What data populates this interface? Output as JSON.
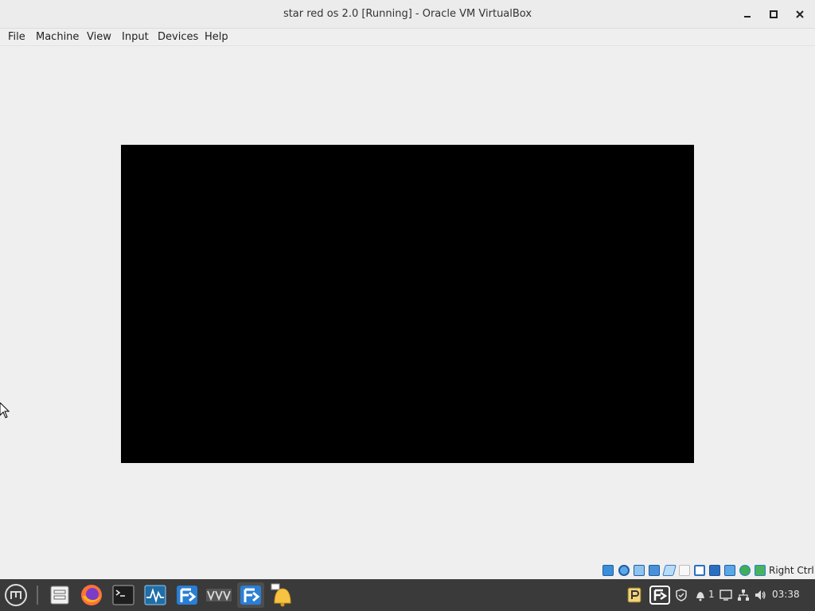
{
  "window": {
    "title": "star red os 2.0 [Running] - Oracle VM VirtualBox",
    "controls": [
      "minimize-icon",
      "maximize-icon",
      "close-icon"
    ]
  },
  "menu": {
    "items": [
      "File",
      "Machine",
      "View",
      "Input",
      "Devices",
      "Help"
    ]
  },
  "vm": {
    "screen_color": "#000000"
  },
  "statusbar": {
    "icons": [
      "hard-disk-icon",
      "optical-drive-icon",
      "audio-icon",
      "network-icon",
      "usb-icon",
      "shared-folders-icon",
      "display-icon",
      "recording-icon",
      "cpu-icon",
      "mouse-integration-icon",
      "keyboard-icon"
    ],
    "host_key": "Right Ctrl"
  },
  "taskbar": {
    "apps": [
      "mint-menu-icon",
      "files-icon",
      "firefox-icon",
      "terminal-icon",
      "system-monitor-icon",
      "virtualbox-manager-icon",
      "vm-app-icon",
      "virtualbox-vm-icon",
      "notifications-icon"
    ],
    "tray": {
      "icons": [
        "package-updater-icon",
        "virtualbox-tray-icon",
        "shield-icon",
        "notification-bell-icon",
        "display-icon",
        "network-icon",
        "volume-icon"
      ],
      "notification_count": "1",
      "clock": "03:38"
    }
  },
  "colors": {
    "window_bg": "#efefef",
    "taskbar_bg": "#3a3a3a",
    "accent_blue": "#2a7fd4"
  }
}
